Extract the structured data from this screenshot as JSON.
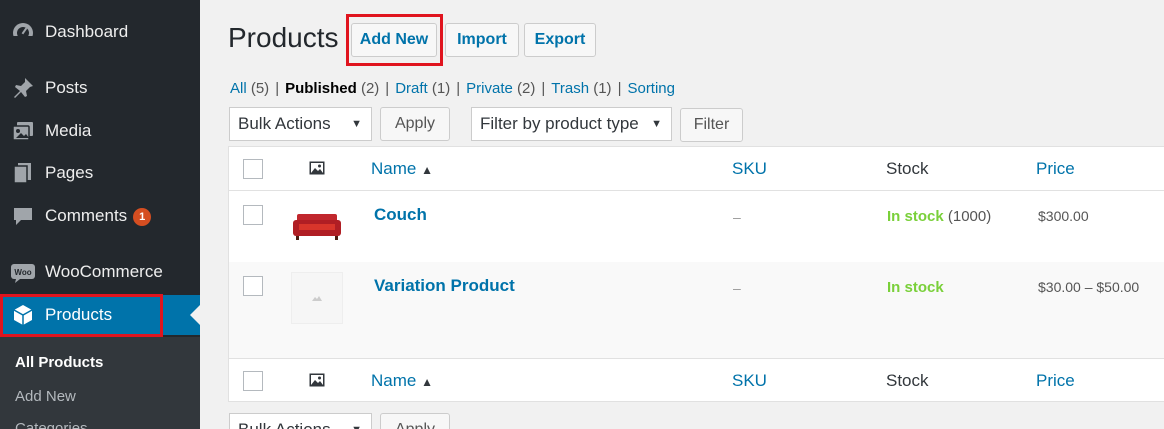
{
  "sidebar": {
    "items": [
      {
        "label": "Dashboard"
      },
      {
        "label": "Posts"
      },
      {
        "label": "Media"
      },
      {
        "label": "Pages"
      },
      {
        "label": "Comments",
        "badge": "1"
      },
      {
        "label": "WooCommerce"
      },
      {
        "label": "Products"
      }
    ],
    "submenu": [
      {
        "label": "All Products"
      },
      {
        "label": "Add New"
      },
      {
        "label": "Categories"
      }
    ]
  },
  "header": {
    "title": "Products",
    "add_new": "Add New",
    "import": "Import",
    "export": "Export"
  },
  "filters": {
    "all": "All",
    "all_count": "(5)",
    "published": "Published",
    "published_count": "(2)",
    "draft": "Draft",
    "draft_count": "(1)",
    "private": "Private",
    "private_count": "(2)",
    "trash": "Trash",
    "trash_count": "(1)",
    "sorting": "Sorting",
    "separator": "|"
  },
  "toolbar": {
    "bulk_actions": "Bulk Actions",
    "apply": "Apply",
    "filter_type": "Filter by product type",
    "filter": "Filter"
  },
  "table": {
    "columns": {
      "name": "Name",
      "sort_indicator": "▲",
      "sku": "SKU",
      "stock": "Stock",
      "price": "Price"
    },
    "rows": [
      {
        "name": "Couch",
        "sku": "–",
        "stock_status": "In stock",
        "stock_qty": "(1000)",
        "price": "$300.00"
      },
      {
        "name": "Variation Product",
        "sku": "–",
        "stock_status": "In stock",
        "stock_qty": "",
        "price": "$30.00 – $50.00"
      }
    ]
  },
  "colors": {
    "sidebar_bg": "#23282d",
    "accent": "#0073aa",
    "highlight": "#e0141e",
    "in_stock": "#7ad03a"
  }
}
